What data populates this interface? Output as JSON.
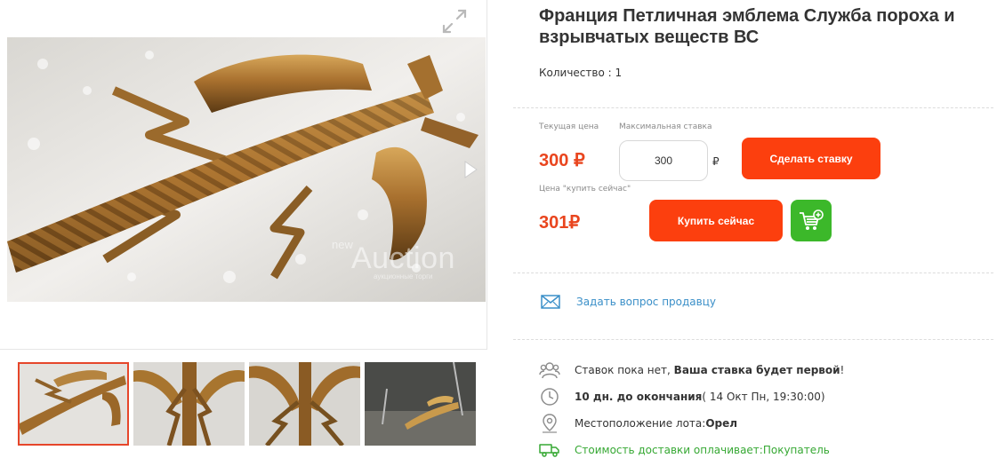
{
  "gallery": {
    "watermark_pre": "new",
    "watermark": "Auction",
    "watermark_sub": "аукционные торги",
    "thumb_count": 4
  },
  "lot": {
    "title": "Франция Петличная эмблема Служба пороха и взрывчатых веществ ВС",
    "quantity_label": "Количество : ",
    "quantity_value": "1"
  },
  "pricing": {
    "current_price_label": "Текущая цена",
    "current_price": "300",
    "max_bid_label": "Максимальная ставка",
    "max_bid_value": "300",
    "currency": "₽",
    "bid_button": "Сделать ставку",
    "buy_now_label": "Цена \"купить сейчас\"",
    "buy_now_price": "301",
    "buy_now_button": "Купить сейчас"
  },
  "seller": {
    "ask_question": "Задать вопрос продавцу"
  },
  "details": {
    "bids_text": "Ставок пока нет, ",
    "bids_bold": "Ваша ставка будет первой",
    "bids_end": "!",
    "time_bold": "10 дн. до окончания",
    "time_rest": " ( 14 Окт Пн, 19:30:00)",
    "location_label": "Местоположение лота: ",
    "location_value": "Орел",
    "delivery_label": "Стоимость доставки оплачивает: ",
    "delivery_value": "Покупатель"
  },
  "colors": {
    "accent": "#fc3f0e",
    "price": "#e9451e",
    "green": "#3cb82a",
    "link": "#3a8fc8"
  }
}
